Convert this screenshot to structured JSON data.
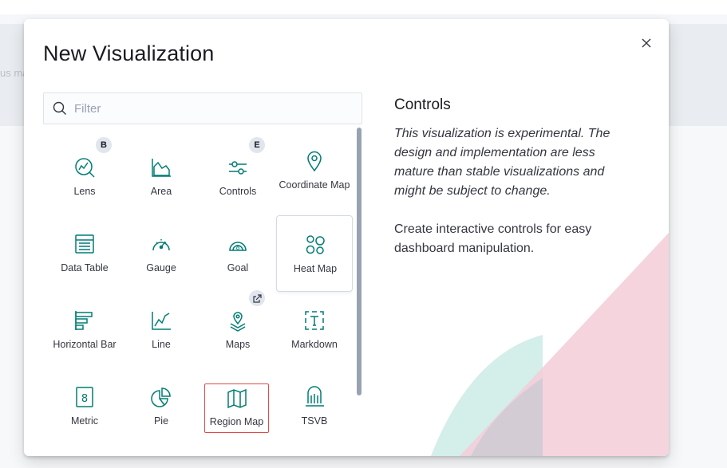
{
  "background": {
    "fragment_text": "us ma"
  },
  "modal": {
    "title": "New Visualization",
    "close_label": "×",
    "search": {
      "placeholder": "Filter",
      "value": ""
    },
    "colors": {
      "icon": "#017d73",
      "selected_border": "#e04a4a"
    },
    "cards": [
      {
        "label": "Lens",
        "icon": "lens-icon",
        "badge": "B"
      },
      {
        "label": "Area",
        "icon": "area-chart-icon"
      },
      {
        "label": "Controls",
        "icon": "controls-icon",
        "badge": "E"
      },
      {
        "label": "Coordinate Map",
        "icon": "map-pin-icon"
      },
      {
        "label": "Data Table",
        "icon": "table-icon"
      },
      {
        "label": "Gauge",
        "icon": "gauge-icon"
      },
      {
        "label": "Goal",
        "icon": "goal-icon"
      },
      {
        "label": "Heat Map",
        "icon": "heat-map-icon",
        "state": "hovered"
      },
      {
        "label": "Horizontal Bar",
        "icon": "horizontal-bar-icon"
      },
      {
        "label": "Line",
        "icon": "line-chart-icon"
      },
      {
        "label": "Maps",
        "icon": "maps-icon",
        "badge_icon": "external-link-icon"
      },
      {
        "label": "Markdown",
        "icon": "markdown-icon"
      },
      {
        "label": "Metric",
        "icon": "metric-icon"
      },
      {
        "label": "Pie",
        "icon": "pie-chart-icon"
      },
      {
        "label": "Region Map",
        "icon": "region-map-icon",
        "state": "selected"
      },
      {
        "label": "TSVB",
        "icon": "tsvb-icon"
      }
    ],
    "description": {
      "title": "Controls",
      "experimental_note": "This visualization is experimental. The design and implementation are less mature than stable visualizations and might be subject to change.",
      "text": "Create interactive controls for easy dashboard manipulation."
    }
  }
}
